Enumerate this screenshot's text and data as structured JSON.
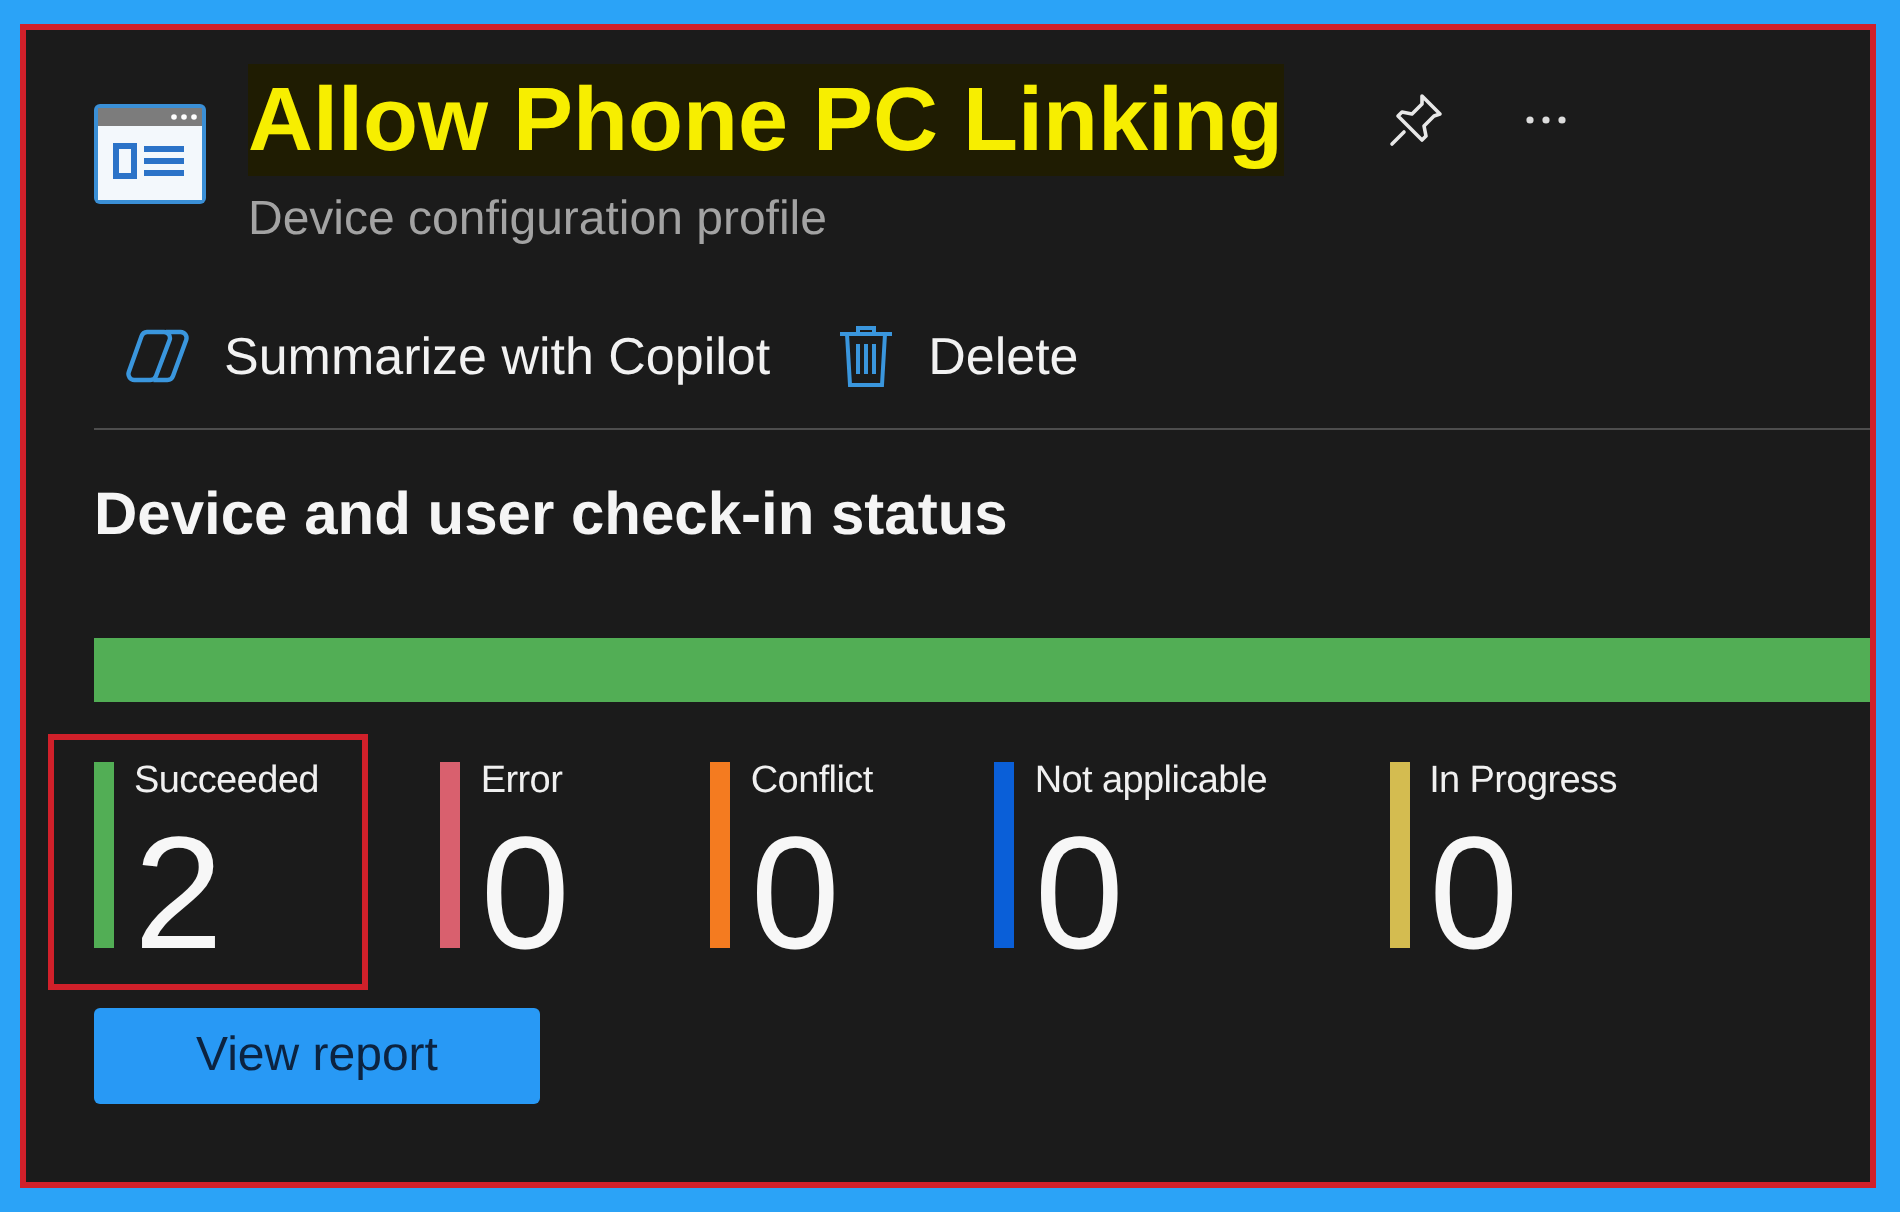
{
  "header": {
    "title": "Allow Phone PC Linking",
    "subtitle": "Device configuration profile"
  },
  "commands": [
    {
      "kind": "copilot",
      "label": "Summarize with Copilot"
    },
    {
      "kind": "delete",
      "label": "Delete"
    }
  ],
  "status": {
    "heading": "Device and user check-in status",
    "tiles": [
      {
        "label": "Succeeded",
        "count": "2",
        "color": "#52ae55",
        "highlighted": true
      },
      {
        "label": "Error",
        "count": "0",
        "color": "#d9606e",
        "highlighted": false
      },
      {
        "label": "Conflict",
        "count": "0",
        "color": "#f47b20",
        "highlighted": false
      },
      {
        "label": "Not applicable",
        "count": "0",
        "color": "#0a5fd8",
        "highlighted": false
      },
      {
        "label": "In Progress",
        "count": "0",
        "color": "#d4bc50",
        "highlighted": false
      }
    ]
  },
  "footer": {
    "button": "View report"
  }
}
